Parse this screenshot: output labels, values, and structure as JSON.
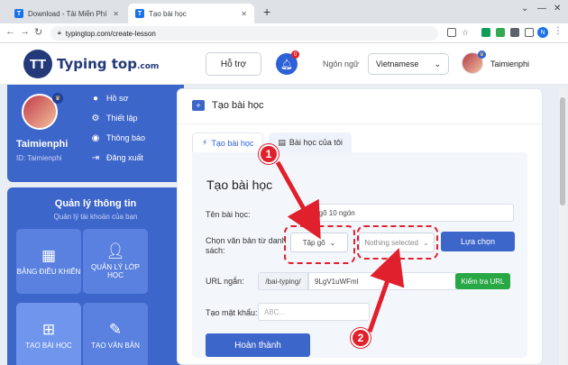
{
  "browser": {
    "tabs": [
      {
        "label": "Download - Tải Miễn Phí VN - Ph",
        "favicon": "T",
        "active": false
      },
      {
        "label": "Tạo bài học",
        "favicon": "T",
        "active": true
      }
    ],
    "new_tab": "+",
    "url": "typingtop.com/create-lesson",
    "profile_initial": "N"
  },
  "header": {
    "logo_text": "Typing top",
    "logo_suffix": ".com",
    "support_label": "Hỗ trợ",
    "notification_count": "0",
    "language_label": "Ngôn ngữ",
    "language_value": "Vietnamese",
    "username": "Taimienphi"
  },
  "profile": {
    "name": "Taimienphi",
    "id_text": "ID: Taimienphi",
    "menu": [
      {
        "label": "Hồ sơ",
        "icon": "user-icon"
      },
      {
        "label": "Thiết lập",
        "icon": "gear-icon"
      },
      {
        "label": "Thông báo",
        "icon": "bell-icon"
      },
      {
        "label": "Đăng xuất",
        "icon": "logout-icon"
      }
    ]
  },
  "management": {
    "title": "Quản lý thông tin",
    "subtitle": "Quản lý tài khoản của bạn",
    "tiles": [
      {
        "label": "BẢNG ĐIỀU KHIỂN",
        "icon": "grid-icon"
      },
      {
        "label": "QUẢN LÝ LỚP HỌC",
        "icon": "users-gear-icon"
      },
      {
        "label": "TẠO BÀI HỌC",
        "icon": "plus-box-icon"
      },
      {
        "label": "TẠO VĂN BẢN",
        "icon": "pencil-icon"
      }
    ]
  },
  "main": {
    "heading": "Tạo bài học",
    "tabs": [
      "Tạo bài học",
      "Bài học của tôi"
    ],
    "form_title": "Tạo bài học",
    "lesson_name_label": "Tên bài học:",
    "lesson_name_value": "n gõ 10 ngón",
    "choose_text_label": "Chọn văn bản từ danh sách:",
    "select1_value": "Tập gõ",
    "select2_value": "Nothing selected",
    "choose_button": "Lựa chọn",
    "url_label": "URL ngắn:",
    "url_prefix": "/bai-typing/",
    "url_value": "9LgV1uWFmI",
    "check_url_button": "Kiểm tra URL",
    "password_label": "Tạo mật khẩu:",
    "password_placeholder": "ABC...",
    "submit_button": "Hoàn thành"
  },
  "annotations": {
    "step1": "1",
    "step2": "2"
  },
  "colors": {
    "primary": "#3d66cb",
    "brand_dark": "#23397a",
    "annotation": "#e0202c",
    "success": "#28a745"
  }
}
